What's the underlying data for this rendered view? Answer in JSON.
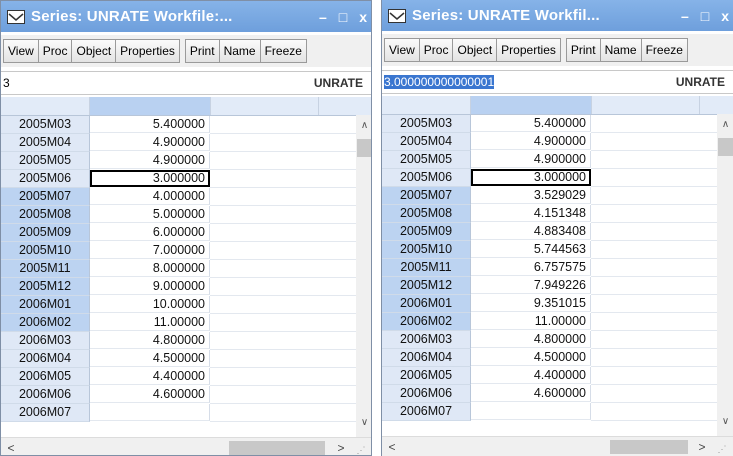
{
  "windows": [
    {
      "title": "Series: UNRATE   Workfile:...",
      "toolbar": [
        "View",
        "Proc",
        "Object",
        "Properties",
        "Print",
        "Name",
        "Freeze"
      ],
      "edit_value": "3",
      "series_label": "UNRATE",
      "rows": [
        {
          "obs": "2005M03",
          "value": "5.400000"
        },
        {
          "obs": "2005M04",
          "value": "4.900000"
        },
        {
          "obs": "2005M05",
          "value": "4.900000"
        },
        {
          "obs": "2005M06",
          "value": "3.000000"
        },
        {
          "obs": "2005M07",
          "value": "4.000000"
        },
        {
          "obs": "2005M08",
          "value": "5.000000"
        },
        {
          "obs": "2005M09",
          "value": "6.000000"
        },
        {
          "obs": "2005M10",
          "value": "7.000000"
        },
        {
          "obs": "2005M11",
          "value": "8.000000"
        },
        {
          "obs": "2005M12",
          "value": "9.000000"
        },
        {
          "obs": "2006M01",
          "value": "10.00000"
        },
        {
          "obs": "2006M02",
          "value": "11.00000"
        },
        {
          "obs": "2006M03",
          "value": "4.800000"
        },
        {
          "obs": "2006M04",
          "value": "4.500000"
        },
        {
          "obs": "2006M05",
          "value": "4.400000"
        },
        {
          "obs": "2006M06",
          "value": "4.600000"
        },
        {
          "obs": "2006M07",
          "value": ""
        }
      ]
    },
    {
      "title": "Series: UNRATE   Workfil...",
      "toolbar": [
        "View",
        "Proc",
        "Object",
        "Properties",
        "Print",
        "Name",
        "Freeze"
      ],
      "edit_value": "3.000000000000001",
      "series_label": "UNRATE",
      "rows": [
        {
          "obs": "2005M03",
          "value": "5.400000"
        },
        {
          "obs": "2005M04",
          "value": "4.900000"
        },
        {
          "obs": "2005M05",
          "value": "4.900000"
        },
        {
          "obs": "2005M06",
          "value": "3.000000"
        },
        {
          "obs": "2005M07",
          "value": "3.529029"
        },
        {
          "obs": "2005M08",
          "value": "4.151348"
        },
        {
          "obs": "2005M09",
          "value": "4.883408"
        },
        {
          "obs": "2005M10",
          "value": "5.744563"
        },
        {
          "obs": "2005M11",
          "value": "6.757575"
        },
        {
          "obs": "2005M12",
          "value": "7.949226"
        },
        {
          "obs": "2006M01",
          "value": "9.351015"
        },
        {
          "obs": "2006M02",
          "value": "11.00000"
        },
        {
          "obs": "2006M03",
          "value": "4.800000"
        },
        {
          "obs": "2006M04",
          "value": "4.500000"
        },
        {
          "obs": "2006M05",
          "value": "4.400000"
        },
        {
          "obs": "2006M06",
          "value": "4.600000"
        },
        {
          "obs": "2006M07",
          "value": ""
        }
      ]
    }
  ],
  "icons": {
    "window": "series-window-icon",
    "minimize": "minimize-icon",
    "restore": "restore-icon",
    "close": "close-icon",
    "scroll_up": "chevron-up-icon",
    "scroll_down": "chevron-down-icon",
    "scroll_left": "chevron-left-icon",
    "scroll_right": "chevron-right-icon",
    "resize_grip": "resize-grip-icon"
  },
  "glyphs": {
    "minimize": "–",
    "restore": "□",
    "close": "x",
    "up": "∧",
    "down": "∨",
    "left": "<",
    "right": ">",
    "grip": "⋰"
  },
  "colors": {
    "titlebar": "#7aaae6",
    "row_header": "#dfe8f6",
    "selected_row_header": "#bcd3f1",
    "selection": "#3a76d0"
  }
}
